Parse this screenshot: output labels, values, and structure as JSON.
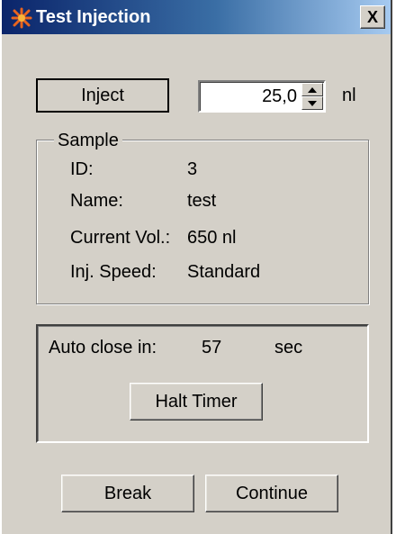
{
  "window": {
    "title": "Test Injection",
    "close_label": "X"
  },
  "inject": {
    "button_label": "Inject",
    "volume_value": "25,0",
    "unit": "nl"
  },
  "sample": {
    "group_label": "Sample",
    "fields": [
      {
        "label": "ID:",
        "value": "3"
      },
      {
        "label": "Name:",
        "value": "test"
      },
      {
        "label": "Current Vol.:",
        "value": "650 nl"
      },
      {
        "label": "Inj. Speed:",
        "value": "Standard"
      }
    ]
  },
  "timer": {
    "label": "Auto close in:",
    "value": "57",
    "unit": "sec",
    "halt_label": "Halt Timer"
  },
  "actions": {
    "break_label": "Break",
    "continue_label": "Continue"
  },
  "icons": {
    "app": "star-burst-icon",
    "close": "close-icon",
    "spin_up": "arrow-up-icon",
    "spin_down": "arrow-down-icon"
  },
  "colors": {
    "dialog_bg": "#d4d0c8",
    "title_start": "#0a246a",
    "title_end": "#a6caf0",
    "app_icon": "#e8641e"
  }
}
